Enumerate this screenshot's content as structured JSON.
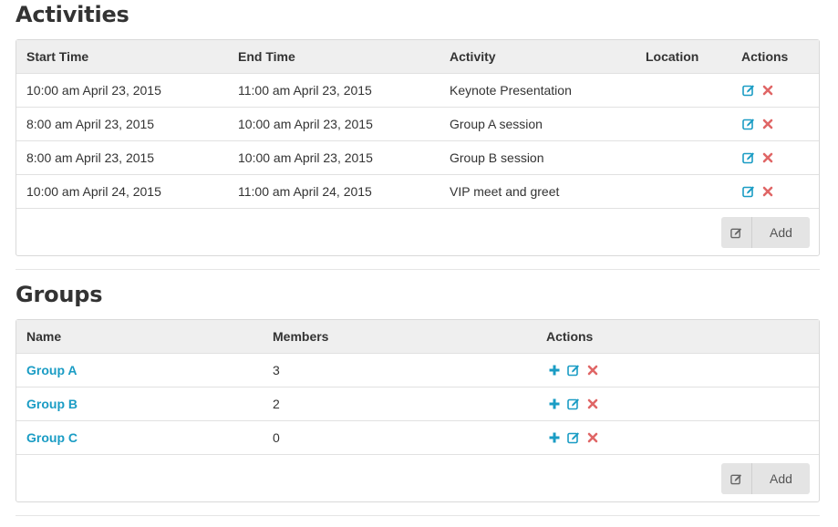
{
  "activities": {
    "title": "Activities",
    "headers": {
      "start": "Start Time",
      "end": "End Time",
      "activity": "Activity",
      "location": "Location",
      "actions": "Actions"
    },
    "rows": [
      {
        "start": "10:00 am April 23, 2015",
        "end": "11:00 am April 23, 2015",
        "activity": "Keynote Presentation",
        "location": ""
      },
      {
        "start": "8:00 am April 23, 2015",
        "end": "10:00 am April 23, 2015",
        "activity": "Group A session",
        "location": ""
      },
      {
        "start": "8:00 am April 23, 2015",
        "end": "10:00 am April 23, 2015",
        "activity": "Group B session",
        "location": ""
      },
      {
        "start": "10:00 am April 24, 2015",
        "end": "11:00 am April 24, 2015",
        "activity": "VIP meet and greet",
        "location": ""
      }
    ],
    "add_label": "Add"
  },
  "groups": {
    "title": "Groups",
    "headers": {
      "name": "Name",
      "members": "Members",
      "actions": "Actions"
    },
    "rows": [
      {
        "name": "Group A",
        "members": "3"
      },
      {
        "name": "Group B",
        "members": "2"
      },
      {
        "name": "Group C",
        "members": "0"
      }
    ],
    "add_label": "Add"
  },
  "icons": {
    "edit": "edit-icon",
    "delete": "delete-icon",
    "add": "plus-icon"
  },
  "colors": {
    "link": "#1a9cc4",
    "delete": "#e06666",
    "edit": "#1a9cc4",
    "header_bg": "#efefef",
    "button_bg": "#e4e4e4"
  }
}
